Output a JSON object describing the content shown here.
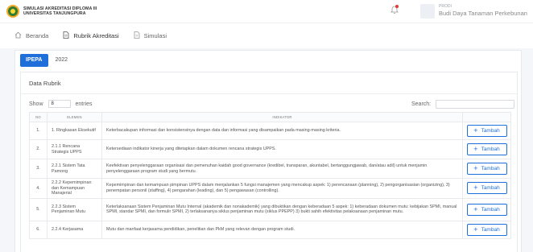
{
  "header": {
    "brand_line1": "SIMULASI AKREDITASI DIPLOMA III",
    "brand_line2": "UNIVERSITAS TANJUNGPURA",
    "user_role": "PRODI",
    "user_name": "Budi Daya Tanaman Perkebunan"
  },
  "nav": {
    "items": [
      {
        "label": "Beranda",
        "icon": "home-icon"
      },
      {
        "label": "Rubrik Akreditasi",
        "icon": "document-icon"
      },
      {
        "label": "Simulasi",
        "icon": "document-icon"
      }
    ]
  },
  "tabs": [
    "IPEPA",
    "2022"
  ],
  "panel": {
    "title": "Data Rubrik",
    "show_label": "Show",
    "entries_value": "8",
    "entries_label": "entries",
    "search_label": "Search:"
  },
  "table": {
    "headers": [
      "NO",
      "ELEMEN",
      "INDIKATOR",
      ""
    ],
    "rows": [
      {
        "no": "1.",
        "elemen": "1. Ringkasan Eksekutif",
        "indikator": "Keterbacakupan informasi dan konsistensinya dengan data dan informasi yang disampaikan pada masing-masing kriteria."
      },
      {
        "no": "2.",
        "elemen": "2.1.1 Rencana Strategis UPPS",
        "indikator": "Ketersediaan indikator kinerja yang ditetapkan dalam dokumen rencana strategis UPPS."
      },
      {
        "no": "3.",
        "elemen": "2.2.1 Sistem Tata Pamong",
        "indikator": "Keefektivan penyelenggaraan organisasi dan pemenuhan kaidah good governance (kredibel, transparan, akuntabel, bertanggungjawab, dan/atau adil) untuk menjamin penyelenggaraan program studi yang bermutu."
      },
      {
        "no": "4.",
        "elemen": "2.2.2 Kepemimpinan dan Kemampuan Manajerial",
        "indikator": "Kepemimpinan dan kemampuan pimpinan UPPS dalam menjalankan 5 fungsi manajemen yang mencakup aspek: 1) perencanaan (planning), 2) pengorganisasian (organizing), 3) penempatan personil (staffing), 4) pengarahan (leading), dan 5) pengawasan (controlling)."
      },
      {
        "no": "5.",
        "elemen": "2.2.3 Sistem Penjaminan Mutu",
        "indikator": "Keterlaksanaan Sistem Penjaminan Mutu Internal (akademik dan nonakademik) yang dibuktikan dengan keberadaan 5 aspek: 1) keberadaan dokumen mutu: kebijakan SPMI, manual SPMI, standar SPMI, dan formulir SPMI, 2) terlaksananya siklus penjaminan mutu (siklus PPEPP) 3) bukti sahih efektivitas pelaksanaan penjaminan mutu."
      },
      {
        "no": "6.",
        "elemen": "2.2.4 Kerjasama",
        "indikator": "Mutu dan manfaat kerjasama pendidikan, penelitian dan PkM yang relevan dengan program studi."
      }
    ],
    "action_label": "Tambah"
  },
  "colors": {
    "accent": "#1e6fd9",
    "background": "#f4f6f9"
  }
}
